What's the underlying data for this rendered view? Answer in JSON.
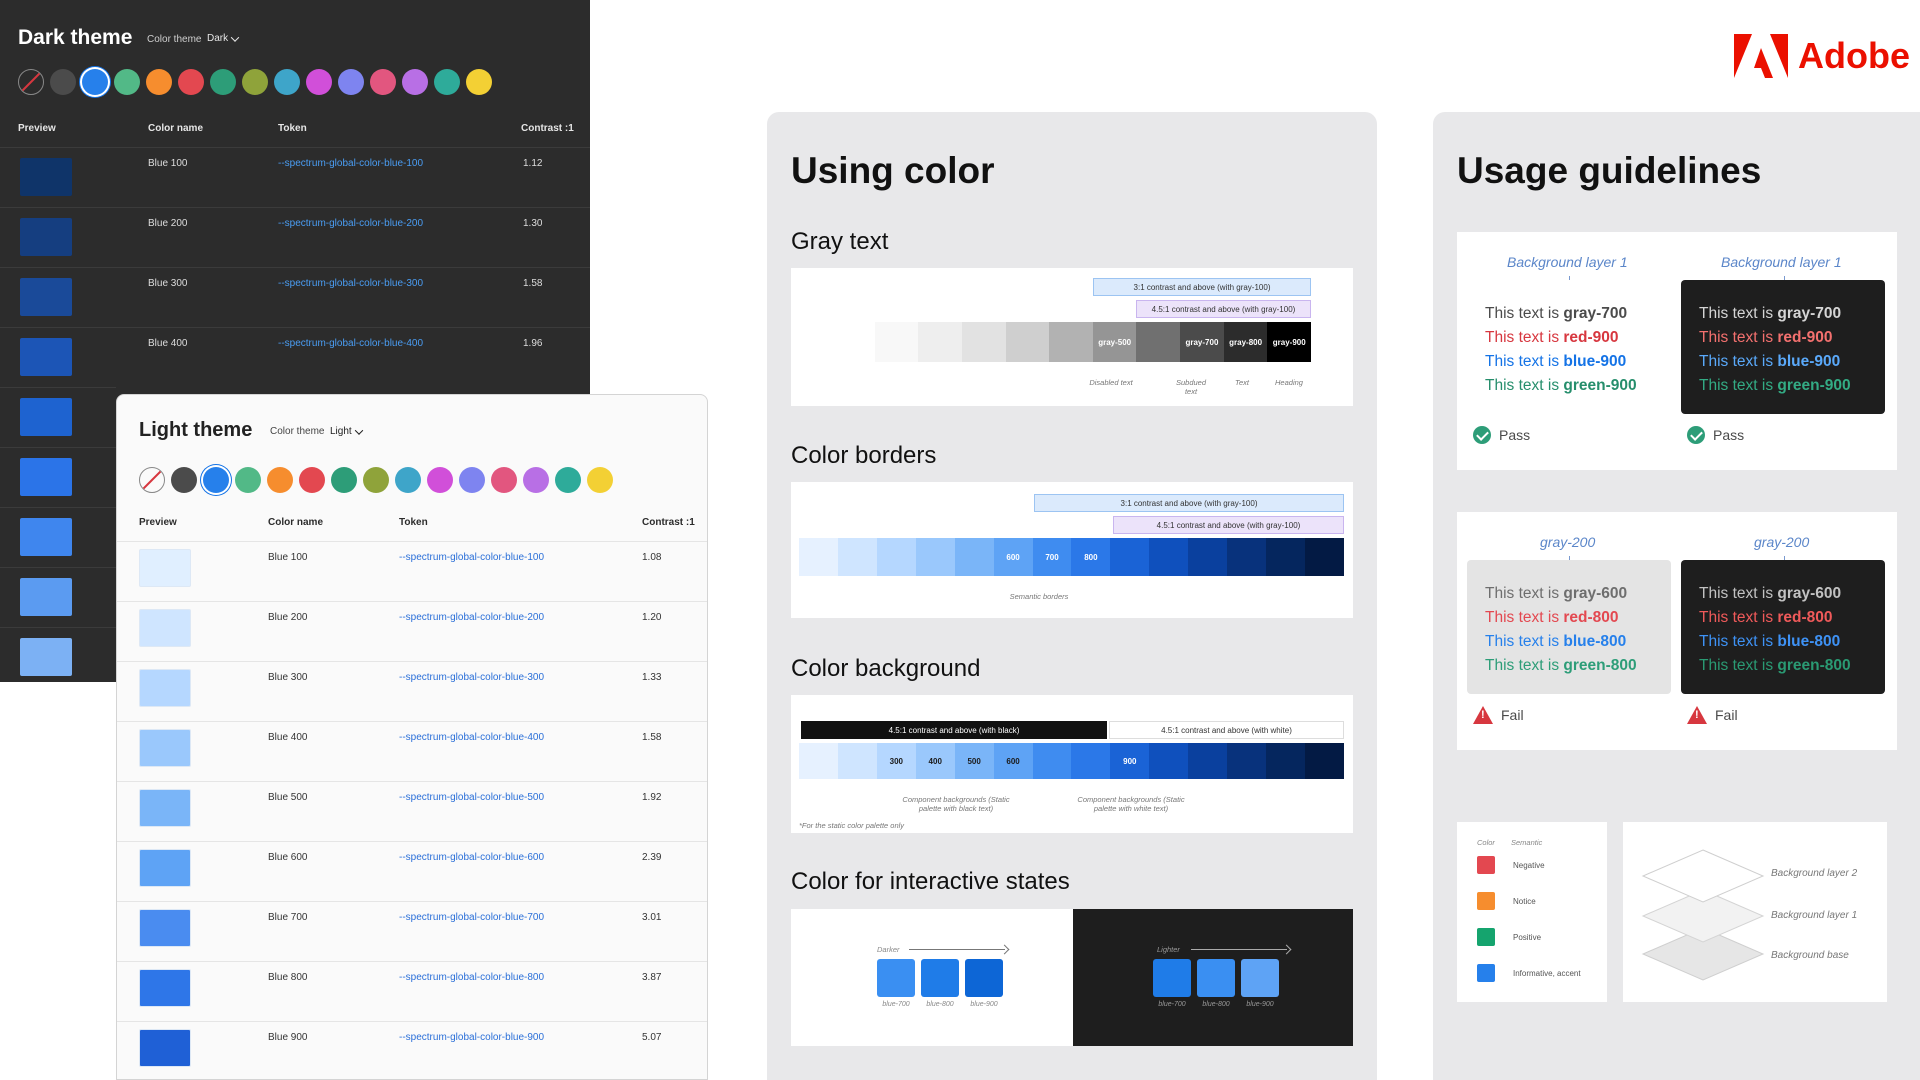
{
  "brand": {
    "name": "Adobe",
    "color": "#eb1000"
  },
  "dark_theme": {
    "title": "Dark theme",
    "color_theme_label": "Color theme",
    "color_theme_value": "Dark",
    "swatches": [
      "none",
      "#4b4b4b",
      "#2680eb",
      "#52b987",
      "#f68d2e",
      "#e34850",
      "#2d9d78",
      "#8fa33a",
      "#3ea5c9",
      "#d14fd9",
      "#7e84f0",
      "#e2567f",
      "#b86fe5",
      "#2eab9a",
      "#f3d034"
    ],
    "columns": {
      "preview": "Preview",
      "color_name": "Color name",
      "token": "Token",
      "contrast": "Contrast :1"
    },
    "rows": [
      {
        "name": "Blue 100",
        "token": "--spectrum-global-color-blue-100",
        "contrast": "1.12",
        "color": "#0f3469"
      },
      {
        "name": "Blue 200",
        "token": "--spectrum-global-color-blue-200",
        "contrast": "1.30",
        "color": "#153e80"
      },
      {
        "name": "Blue 300",
        "token": "--spectrum-global-color-blue-300",
        "contrast": "1.58",
        "color": "#1a4a99"
      },
      {
        "name": "Blue 400",
        "token": "--spectrum-global-color-blue-400",
        "contrast": "1.96",
        "color": "#1c55b6"
      }
    ],
    "extra_preview_colors": [
      "#1e63d0",
      "#2b74e8",
      "#3f86ee",
      "#5b9bf1",
      "#7cb1f4"
    ]
  },
  "light_theme": {
    "title": "Light theme",
    "color_theme_label": "Color theme",
    "color_theme_value": "Light",
    "swatches": [
      "none",
      "#4b4b4b",
      "#2680eb",
      "#52b987",
      "#f68d2e",
      "#e34850",
      "#2d9d78",
      "#8fa33a",
      "#3ea5c9",
      "#d14fd9",
      "#7e84f0",
      "#e2567f",
      "#b86fe5",
      "#2eab9a",
      "#f3d034"
    ],
    "columns": {
      "preview": "Preview",
      "color_name": "Color name",
      "token": "Token",
      "contrast": "Contrast :1"
    },
    "rows": [
      {
        "name": "Blue 100",
        "token": "--spectrum-global-color-blue-100",
        "contrast": "1.08",
        "color": "#e0efff"
      },
      {
        "name": "Blue 200",
        "token": "--spectrum-global-color-blue-200",
        "contrast": "1.20",
        "color": "#cfe5ff"
      },
      {
        "name": "Blue 300",
        "token": "--spectrum-global-color-blue-300",
        "contrast": "1.33",
        "color": "#b5d7ff"
      },
      {
        "name": "Blue 400",
        "token": "--spectrum-global-color-blue-400",
        "contrast": "1.58",
        "color": "#9ac8fc"
      },
      {
        "name": "Blue 500",
        "token": "--spectrum-global-color-blue-500",
        "contrast": "1.92",
        "color": "#7ab5f8"
      },
      {
        "name": "Blue 600",
        "token": "--spectrum-global-color-blue-600",
        "contrast": "2.39",
        "color": "#5ea3f5"
      },
      {
        "name": "Blue 700",
        "token": "--spectrum-global-color-blue-700",
        "contrast": "3.01",
        "color": "#4a8cf0"
      },
      {
        "name": "Blue 800",
        "token": "--spectrum-global-color-blue-800",
        "contrast": "3.87",
        "color": "#2e76e8"
      },
      {
        "name": "Blue 900",
        "token": "--spectrum-global-color-blue-900",
        "contrast": "5.07",
        "color": "#1f60d6"
      }
    ]
  },
  "using_color": {
    "title": "Using color",
    "gray_text": {
      "heading": "Gray text",
      "bar_3to1": "3:1 contrast and above (with gray-100)",
      "bar_45to1": "4.5:1 contrast and above (with gray-100)",
      "steps": [
        {
          "color": "#ffffff",
          "label": ""
        },
        {
          "color": "#f8f8f8",
          "label": ""
        },
        {
          "color": "#eeeeee",
          "label": ""
        },
        {
          "color": "#e2e2e2",
          "label": ""
        },
        {
          "color": "#cfcfcf",
          "label": ""
        },
        {
          "color": "#b2b2b2",
          "label": ""
        },
        {
          "color": "#959595",
          "label": "gray-500"
        },
        {
          "color": "#707070",
          "label": ""
        },
        {
          "color": "#4b4b4b",
          "label": "gray-700"
        },
        {
          "color": "#2c2c2c",
          "label": "gray-800"
        },
        {
          "color": "#000000",
          "label": "gray-900"
        }
      ],
      "captions": [
        "Disabled text",
        "Subdued text",
        "Text",
        "Heading"
      ]
    },
    "color_borders": {
      "heading": "Color borders",
      "bar_3to1": "3:1 contrast and above (with gray-100)",
      "bar_45to1": "4.5:1 contrast and above (with gray-100)",
      "steps": [
        {
          "color": "#e6f1ff",
          "label": ""
        },
        {
          "color": "#cfe5ff",
          "label": ""
        },
        {
          "color": "#b5d7ff",
          "label": ""
        },
        {
          "color": "#9ac8fc",
          "label": ""
        },
        {
          "color": "#7ab5f8",
          "label": ""
        },
        {
          "color": "#5ea3f5",
          "label": "600"
        },
        {
          "color": "#3f8cf0",
          "label": "700"
        },
        {
          "color": "#2b78e8",
          "label": "800"
        },
        {
          "color": "#1a63d6",
          "label": ""
        },
        {
          "color": "#0f50bd",
          "label": ""
        },
        {
          "color": "#0a409e",
          "label": ""
        },
        {
          "color": "#08327c",
          "label": ""
        },
        {
          "color": "#05265e",
          "label": ""
        },
        {
          "color": "#031a44",
          "label": ""
        }
      ],
      "caption": "Semantic borders"
    },
    "color_background": {
      "heading": "Color background",
      "bar_black": "4.5:1 contrast and above (with black)",
      "bar_white": "4.5:1 contrast and above (with white)",
      "steps": [
        {
          "color": "#e6f1ff",
          "label": ""
        },
        {
          "color": "#cfe5ff",
          "label": ""
        },
        {
          "color": "#b5d7ff",
          "label": "300"
        },
        {
          "color": "#9ac8fc",
          "label": "400"
        },
        {
          "color": "#7ab5f8",
          "label": "500"
        },
        {
          "color": "#5ea3f5",
          "label": "600"
        },
        {
          "color": "#3f8cf0",
          "label": ""
        },
        {
          "color": "#2b78e8",
          "label": ""
        },
        {
          "color": "#1a63d6",
          "label": "900"
        },
        {
          "color": "#0f50bd",
          "label": ""
        },
        {
          "color": "#0a409e",
          "label": ""
        },
        {
          "color": "#08327c",
          "label": ""
        },
        {
          "color": "#05265e",
          "label": ""
        },
        {
          "color": "#031a44",
          "label": ""
        }
      ],
      "caption_black": "Component backgrounds (Static palette with black text)",
      "caption_white": "Component backgrounds (Static palette with white text)",
      "footnote": "*For the static color palette only"
    },
    "interactive_states": {
      "heading": "Color for interactive states",
      "darker": "Darker",
      "lighter": "Lighter",
      "light_swatches": [
        {
          "color": "#3a8ff2",
          "label": "blue-700"
        },
        {
          "color": "#1f7ce8",
          "label": "blue-800"
        },
        {
          "color": "#0d66d6",
          "label": "blue-900"
        }
      ],
      "dark_swatches": [
        {
          "color": "#1f7ce8",
          "label": "blue-700"
        },
        {
          "color": "#3a8ff2",
          "label": "blue-800"
        },
        {
          "color": "#5ea3f5",
          "label": "blue-900"
        }
      ]
    }
  },
  "usage_guidelines": {
    "title": "Usage guidelines",
    "pass_examples": [
      {
        "layer": "Background layer 1",
        "theme": "light",
        "status": "Pass"
      },
      {
        "layer": "Background layer 1",
        "theme": "dark",
        "status": "Pass"
      }
    ],
    "pass_lines": [
      {
        "prefix": "This text is ",
        "token": "gray-700",
        "light": "#4b4b4b",
        "dark": "#d5d5d5"
      },
      {
        "prefix": "This text is ",
        "token": "red-900",
        "light": "#d7373f",
        "dark": "#f4716f"
      },
      {
        "prefix": "This text is ",
        "token": "blue-900",
        "light": "#1473e6",
        "dark": "#5aa9fa"
      },
      {
        "prefix": "This text is ",
        "token": "green-900",
        "light": "#268e6c",
        "dark": "#33ab84"
      }
    ],
    "fail_examples": [
      {
        "layer": "gray-200",
        "theme": "light",
        "status": "Fail"
      },
      {
        "layer": "gray-200",
        "theme": "dark",
        "status": "Fail"
      }
    ],
    "fail_lines": [
      {
        "prefix": "This text is ",
        "token": "gray-600",
        "light": "#6e6e6e",
        "dark": "#c2c2c2"
      },
      {
        "prefix": "This text is ",
        "token": "red-800",
        "light": "#e34850",
        "dark": "#f05a5a"
      },
      {
        "prefix": "This text is ",
        "token": "blue-800",
        "light": "#2680eb",
        "dark": "#3e92f5"
      },
      {
        "prefix": "This text is ",
        "token": "green-800",
        "light": "#2d9d78",
        "dark": "#2a9a73"
      }
    ],
    "legend": {
      "header_color": "Color",
      "header_semantic": "Semantic",
      "items": [
        {
          "color": "#e34850",
          "label": "Negative"
        },
        {
          "color": "#f68d2e",
          "label": "Notice"
        },
        {
          "color": "#15a46e",
          "label": "Positive"
        },
        {
          "color": "#2680eb",
          "label": "Informative, accent"
        }
      ]
    },
    "layers": [
      "Background layer 2",
      "Background layer 1",
      "Background base"
    ]
  }
}
